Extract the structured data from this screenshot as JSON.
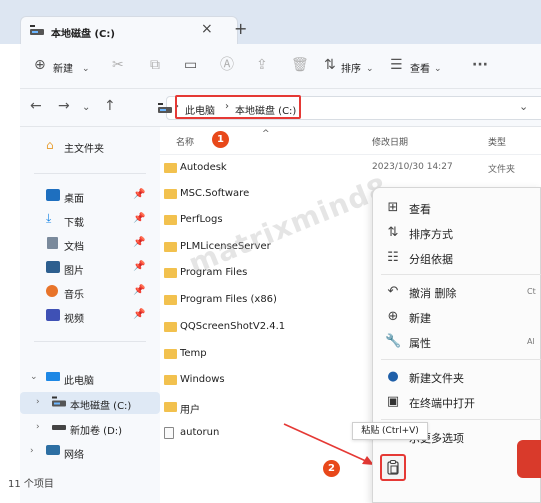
{
  "window": {
    "tab_title": "本地磁盘 (C:)",
    "tab_close": "×",
    "new_tab": "+"
  },
  "toolbar": {
    "new_label": "新建",
    "sort_label": "排序",
    "view_label": "查看",
    "more": "···"
  },
  "address": {
    "crumbs": [
      "此电脑",
      "本地磁盘 (C:)"
    ],
    "separator": "›",
    "dropdown": "⌄"
  },
  "sidebar": {
    "home": "主文件夹",
    "quick": [
      {
        "label": "桌面"
      },
      {
        "label": "下载"
      },
      {
        "label": "文档"
      },
      {
        "label": "图片"
      },
      {
        "label": "音乐"
      },
      {
        "label": "视频"
      }
    ],
    "this_pc": "此电脑",
    "drives": [
      {
        "label": "本地磁盘 (C:)"
      },
      {
        "label": "新加卷 (D:)"
      }
    ],
    "network": "网络",
    "status": "11 个项目"
  },
  "filelist": {
    "col_name": "名称",
    "col_date": "修改日期",
    "col_type": "类型",
    "sort_indicator": "^",
    "files": [
      {
        "name": "Autodesk",
        "date": "2023/10/30 14:27",
        "type": "文件夹"
      },
      {
        "name": "MSC.Software"
      },
      {
        "name": "PerfLogs"
      },
      {
        "name": "PLMLicenseServer"
      },
      {
        "name": "Program Files"
      },
      {
        "name": "Program Files (x86)"
      },
      {
        "name": "QQScreenShotV2.4.1"
      },
      {
        "name": "Temp"
      },
      {
        "name": "Windows"
      },
      {
        "name": "用户"
      },
      {
        "name": "autorun"
      }
    ]
  },
  "watermark": "matrixmind8",
  "badges": {
    "one": "1",
    "two": "2"
  },
  "context_menu": {
    "items": [
      {
        "label": "查看",
        "icon": "grid-icon"
      },
      {
        "label": "排序方式",
        "icon": "sort-icon"
      },
      {
        "label": "分组依据",
        "icon": "group-icon"
      },
      {
        "label": "撤消 删除",
        "icon": "undo-icon",
        "shortcut": "Ct"
      },
      {
        "label": "新建",
        "icon": "plus-circle-icon"
      },
      {
        "label": "属性",
        "icon": "wrench-icon",
        "shortcut": "Al"
      },
      {
        "label": "新建文件夹",
        "icon": "new-folder-icon"
      },
      {
        "label": "在终端中打开",
        "icon": "terminal-icon"
      },
      {
        "label": "示更多选项",
        "icon": "more-options-icon"
      }
    ]
  },
  "tooltip": "粘贴 (Ctrl+V)",
  "colors": {
    "accent": "#0067c0",
    "badge": "#e8481a",
    "highlight": "#e53935",
    "folder": "#f2c14e"
  }
}
